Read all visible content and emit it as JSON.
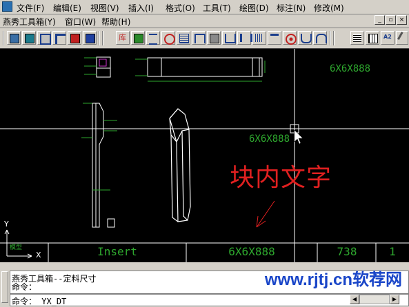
{
  "menu_main": [
    "文件(F)",
    "编辑(E)",
    "视图(V)",
    "插入(I)",
    "格式(O)",
    "工具(T)",
    "绘图(D)",
    "标注(N)",
    "修改(M)"
  ],
  "menu_secondary": [
    "燕秀工具箱(Y)",
    "窗口(W)",
    "帮助(H)"
  ],
  "window_buttons": [
    "_",
    "▫",
    "×"
  ],
  "toolbar_icons": [
    "screen-icon",
    "layer-icon",
    "mold-base-icon",
    "trim-icon",
    "gate-icon",
    "ejector-icon",
    "library-icon",
    "insert-block-icon",
    "spring-icon",
    "circle-cross-icon",
    "cylinder-icon",
    "fit-icon",
    "screw-icon",
    "slot-icon",
    "bolt-icon",
    "thread-icon",
    "tee-icon",
    "target-icon",
    "cup-icon",
    "arch-icon",
    "grid-icon",
    "table-icon",
    "text-size-icon",
    "wrench-icon"
  ],
  "drawing": {
    "label_top_right": "6X6X888",
    "label_center": "6X6X888",
    "annotation": "块内文字",
    "ucs_y": "Y",
    "ucs_x": "X",
    "ucs_label": "模型"
  },
  "status": {
    "mode": "Insert",
    "text": "6X6X888",
    "value": "738",
    "count": "1"
  },
  "command": {
    "history": "燕秀工具箱--定料尺寸",
    "prompt1": "命令：",
    "prompt2": "命令： YX_DT"
  },
  "watermark": "www.rjtj.cn软荐网",
  "colors": {
    "canvas": "#000000",
    "text_green": "#2ea82e",
    "annotation_red": "#e02020",
    "watermark": "#1a46c8"
  }
}
